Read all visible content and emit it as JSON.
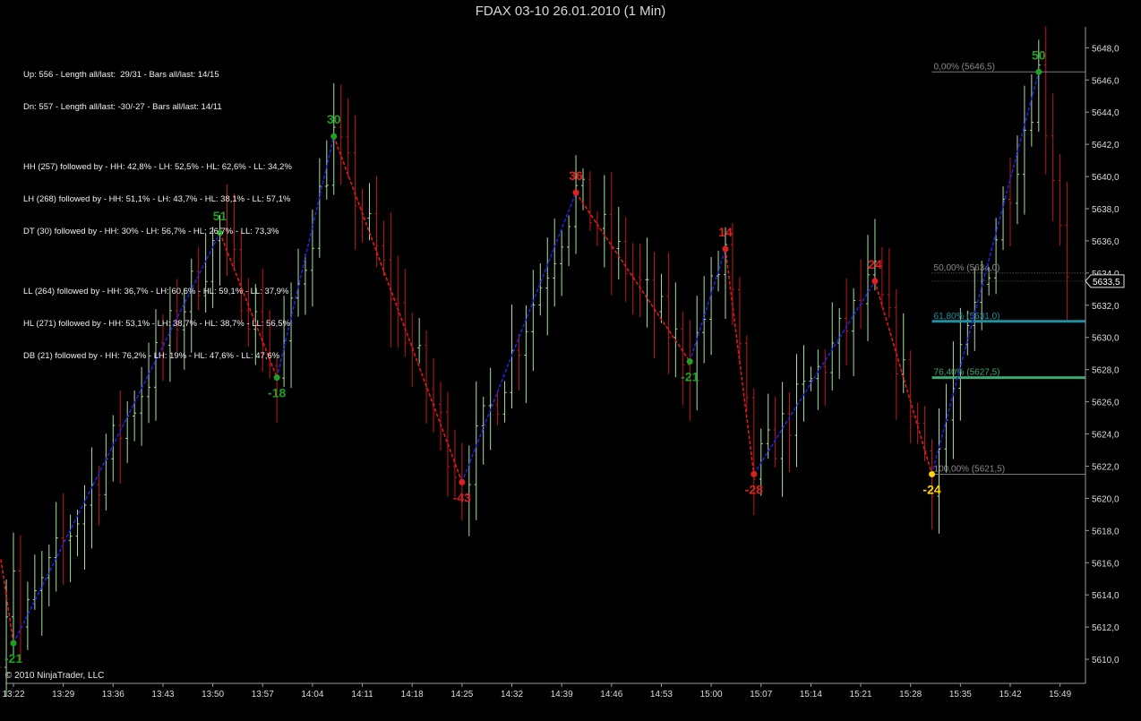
{
  "window": {
    "title": "FDAX 03-10  26.01.2010 (1 Min)"
  },
  "stats": {
    "up": "Up: 556 - Length all/last:  29/31 - Bars all/last: 14/15",
    "dn": "Dn: 557 - Length all/last: -30/-27 - Bars all/last: 14/11",
    "hh": "HH (257) followed by - HH: 42,8% - LH: 52,5% - HL: 62,6% - LL: 34,2%",
    "lh": "LH (268) followed by - HH: 51,1% - LH: 43,7% - HL: 38,1% - LL: 57,1%",
    "dt": "DT (30) followed by - HH: 30% - LH: 56,7% - HL: 26,7% - LL: 73,3%",
    "ll": "LL (264) followed by - HH: 36,7% - LH: 60,6% - HL: 59,1% - LL: 37,9%",
    "hl": "HL (271) followed by - HH: 53,1% - LH: 38,7% - HL: 38,7% - LL: 56,5%",
    "db": "DB (21) followed by - HH: 76,2% - LH: 19% - HL: 47,6% - LL: 47,6%"
  },
  "copyright": "© 2010 NinjaTrader, LLC",
  "colors": {
    "background": "#000000",
    "up_bar": "#a8e0a0",
    "down_bar": "#c01818",
    "up_swing_line": "#2020e0",
    "down_swing_line": "#e01818",
    "low_label": "#1fa01f",
    "high_label": "#e02020",
    "current_label": "#ffd700",
    "fib_line": "#7a7a7a",
    "fib_618": "#1f8fa0",
    "fib_764": "#3aa870",
    "axis_text": "#dcdcdc"
  },
  "chart_data": {
    "type": "ohlc",
    "x_ticks": [
      "13:22",
      "13:29",
      "13:36",
      "13:43",
      "13:50",
      "13:57",
      "14:04",
      "14:11",
      "14:18",
      "14:25",
      "14:32",
      "14:39",
      "14:46",
      "14:53",
      "15:00",
      "15:07",
      "15:14",
      "15:21",
      "15:28",
      "15:35",
      "15:42",
      "15:49"
    ],
    "ylim": [
      5608.5,
      5649.3
    ],
    "y_ticks": [
      5610,
      5612,
      5614,
      5616,
      5618,
      5620,
      5622,
      5624,
      5626,
      5628,
      5630,
      5632,
      5634,
      5636,
      5638,
      5640,
      5642,
      5644,
      5646,
      5648
    ],
    "y_tick_labels": [
      "5610,0",
      "5612,0",
      "5614,0",
      "5616,0",
      "5618,0",
      "5620,0",
      "5622,0",
      "5624,0",
      "5626,0",
      "5628,0",
      "5630,0",
      "5632,0",
      "5634,0",
      "5636,0",
      "5638,0",
      "5640,0",
      "5642,0",
      "5644,0",
      "5646,0",
      "5648,0"
    ],
    "last_price": {
      "value": 5633.5,
      "label": "5633,5"
    },
    "swings": [
      {
        "time": "13:22",
        "price": 5611.0,
        "label": "-21",
        "kind": "low"
      },
      {
        "time": "13:51",
        "price": 5636.5,
        "label": "51",
        "kind": "high"
      },
      {
        "time": "13:59",
        "price": 5627.5,
        "label": "-18",
        "kind": "low"
      },
      {
        "time": "14:07",
        "price": 5642.5,
        "label": "30",
        "kind": "high"
      },
      {
        "time": "14:25",
        "price": 5621.0,
        "label": "-43",
        "kind": "low"
      },
      {
        "time": "14:41",
        "price": 5639.0,
        "label": "36",
        "kind": "high"
      },
      {
        "time": "14:57",
        "price": 5628.5,
        "label": "-21",
        "kind": "low"
      },
      {
        "time": "15:02",
        "price": 5635.5,
        "label": "14",
        "kind": "high"
      },
      {
        "time": "15:06",
        "price": 5621.5,
        "label": "-28",
        "kind": "low"
      },
      {
        "time": "15:23",
        "price": 5633.5,
        "label": "24",
        "kind": "high"
      },
      {
        "time": "15:31",
        "price": 5621.5,
        "label": "-24",
        "kind": "current"
      },
      {
        "time": "15:46",
        "price": 5646.5,
        "label": "50",
        "kind": "high"
      }
    ],
    "fib_levels": [
      {
        "price": 5646.5,
        "label": "0,00% (5646,5)",
        "style": "thin"
      },
      {
        "price": 5634.0,
        "label": "50,00% (5634,0)",
        "style": "dotted"
      },
      {
        "price": 5631.0,
        "label": "61,80% (5631,0)",
        "style": "thick-teal"
      },
      {
        "price": 5627.5,
        "label": "76,40% (5627,5)",
        "style": "thick-green"
      },
      {
        "price": 5621.5,
        "label": "100,00% (5621,5)",
        "style": "thin"
      }
    ]
  }
}
